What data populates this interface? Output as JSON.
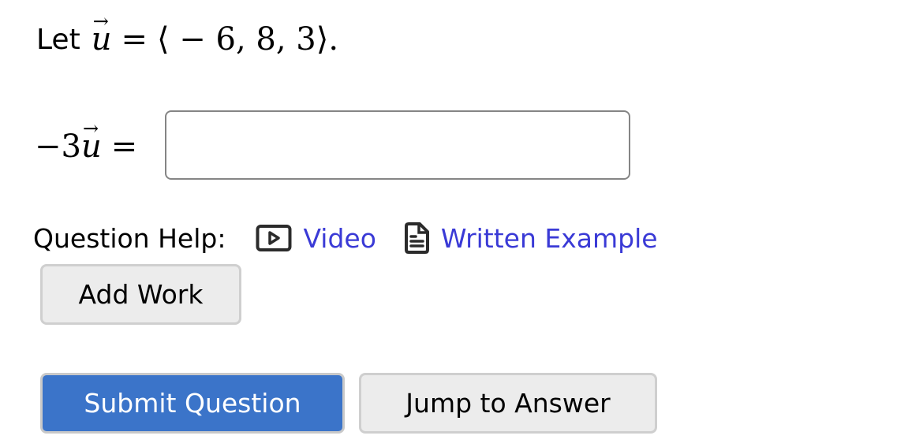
{
  "question": {
    "intro_text": "Let",
    "vector_name": "u",
    "vector_arrow": "→",
    "equals": "=",
    "vector_value": "⟨ − 6, 8, 3⟩.",
    "prompt_coefficient": "−3",
    "prompt_vector_name": "u",
    "prompt_equals": "="
  },
  "answer_input": {
    "value": "",
    "placeholder": ""
  },
  "help": {
    "label": "Question Help:",
    "links": [
      {
        "label": "Video",
        "icon": "video-play-icon"
      },
      {
        "label": "Written Example",
        "icon": "document-icon"
      }
    ]
  },
  "buttons": {
    "add_work": "Add Work",
    "submit": "Submit Question",
    "jump": "Jump to Answer"
  },
  "colors": {
    "link": "#3a3ad6",
    "primary_button": "#3b74c9",
    "secondary_button": "#ececec"
  }
}
